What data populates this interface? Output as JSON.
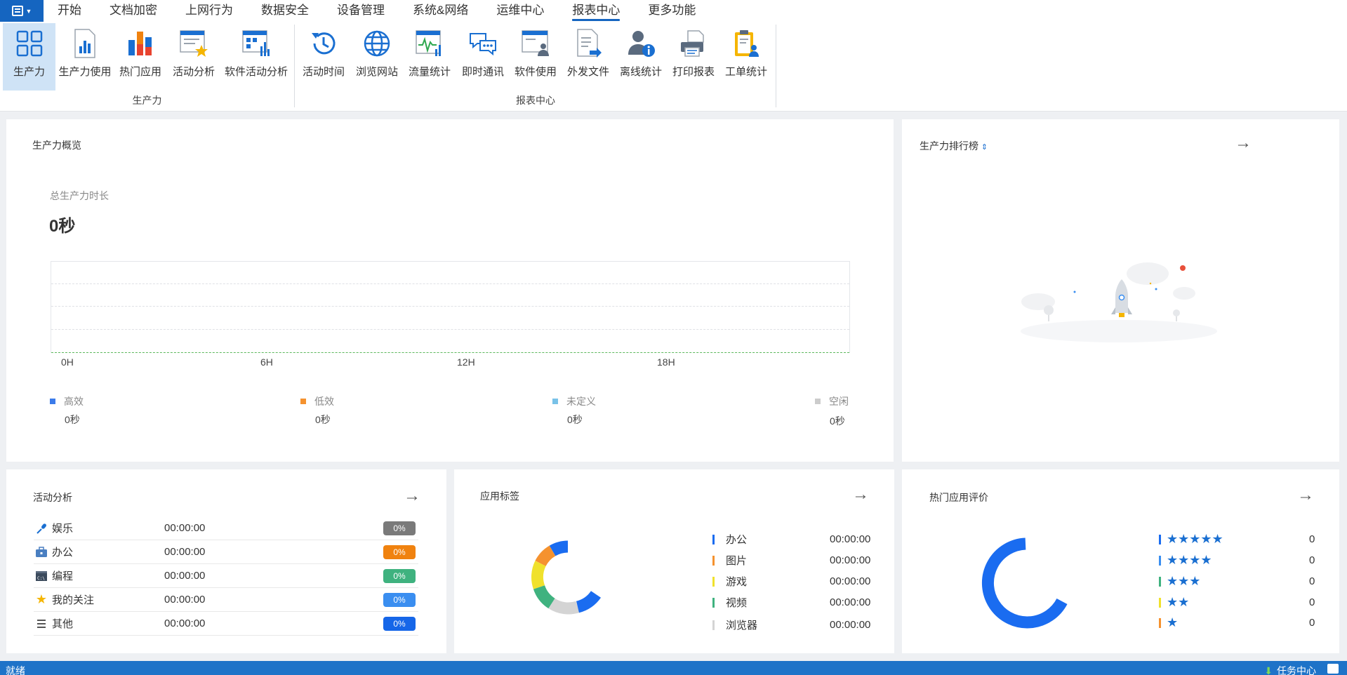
{
  "menubar": {
    "items": [
      "开始",
      "文档加密",
      "上网行为",
      "数据安全",
      "设备管理",
      "系统&网络",
      "运维中心",
      "报表中心",
      "更多功能"
    ],
    "active": "报表中心"
  },
  "ribbon": {
    "group1": {
      "label": "生产力",
      "buttons": [
        "生产力",
        "生产力使用",
        "热门应用",
        "活动分析",
        "软件活动分析"
      ]
    },
    "group2": {
      "label": "报表中心",
      "buttons": [
        "活动时间",
        "浏览网站",
        "流量统计",
        "即时通讯",
        "软件使用",
        "外发文件",
        "离线统计",
        "打印报表",
        "工单统计"
      ]
    }
  },
  "overview": {
    "title": "生产力概览",
    "total_label": "总生产力时长",
    "total_value": "0秒",
    "x_ticks": [
      "0H",
      "6H",
      "12H",
      "18H"
    ],
    "legend": [
      {
        "label": "高效",
        "value": "0秒",
        "color": "#3b7bea"
      },
      {
        "label": "低效",
        "value": "0秒",
        "color": "#f5922f"
      },
      {
        "label": "未定义",
        "value": "0秒",
        "color": "#79c2e8"
      },
      {
        "label": "空闲",
        "value": "0秒",
        "color": "#cccccc"
      }
    ]
  },
  "ranking": {
    "title": "生产力排行榜",
    "sort_icon": "⇕",
    "arrow": "→"
  },
  "activity": {
    "title": "活动分析",
    "arrow": "→",
    "rows": [
      {
        "name": "娱乐",
        "time": "00:00:00",
        "pct": "0%",
        "color": "#7a7a7a",
        "icon": "microphone-icon"
      },
      {
        "name": "办公",
        "time": "00:00:00",
        "pct": "0%",
        "color": "#f0820f",
        "icon": "briefcase-icon"
      },
      {
        "name": "编程",
        "time": "00:00:00",
        "pct": "0%",
        "color": "#3fb27f",
        "icon": "terminal-icon"
      },
      {
        "name": "我的关注",
        "time": "00:00:00",
        "pct": "0%",
        "color": "#3a8ef0",
        "icon": "star-icon"
      },
      {
        "name": "其他",
        "time": "00:00:00",
        "pct": "0%",
        "color": "#1666e8",
        "icon": "list-icon"
      }
    ]
  },
  "tags": {
    "title": "应用标签",
    "arrow": "→",
    "rows": [
      {
        "name": "办公",
        "time": "00:00:00",
        "color": "#1a6cf0"
      },
      {
        "name": "图片",
        "time": "00:00:00",
        "color": "#f5922f"
      },
      {
        "name": "游戏",
        "time": "00:00:00",
        "color": "#f0e12c"
      },
      {
        "name": "视频",
        "time": "00:00:00",
        "color": "#3fb27f"
      },
      {
        "name": "浏览器",
        "time": "00:00:00",
        "color": "#d4d4d4"
      }
    ]
  },
  "rating": {
    "title": "热门应用评价",
    "arrow": "→",
    "rows": [
      {
        "stars": "★★★★★",
        "value": "0",
        "color": "#1a6cf0"
      },
      {
        "stars": "★★★★",
        "value": "0",
        "color": "#3a8ef0"
      },
      {
        "stars": "★★★",
        "value": "0",
        "color": "#3fb27f"
      },
      {
        "stars": "★★",
        "value": "0",
        "color": "#f0e12c"
      },
      {
        "stars": "★",
        "value": "0",
        "color": "#f5922f"
      }
    ]
  },
  "statusbar": {
    "left": "就绪",
    "task_center": "任务中心"
  }
}
